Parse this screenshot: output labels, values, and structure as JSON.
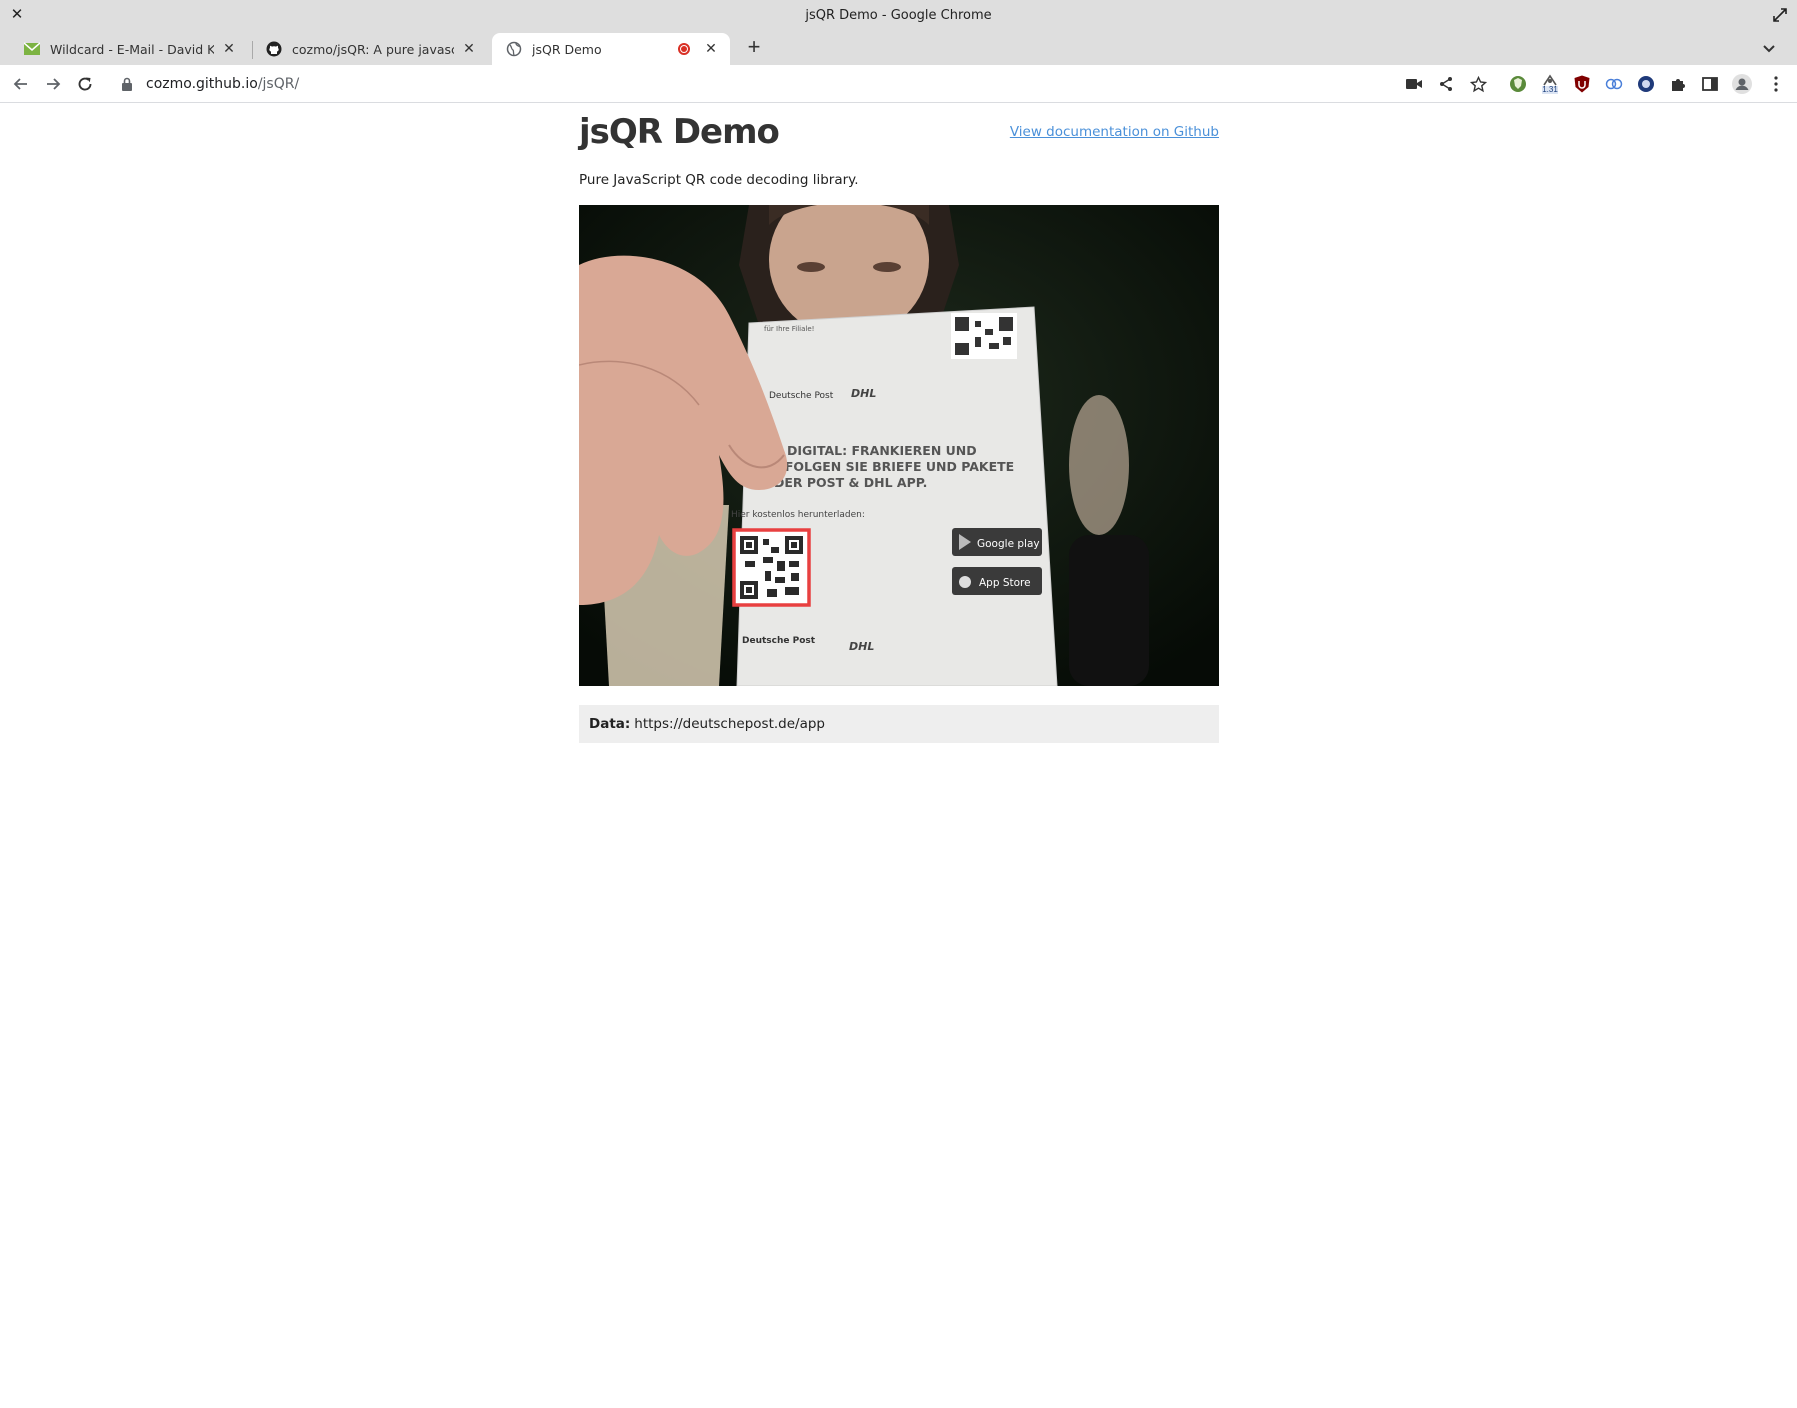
{
  "window": {
    "title": "jsQR Demo - Google Chrome"
  },
  "tabs": [
    {
      "label": "Wildcard - E-Mail - David Kleuk",
      "icon": "mail-icon",
      "active": false
    },
    {
      "label": "cozmo/jsQR: A pure javascript QR",
      "icon": "github-icon",
      "active": false
    },
    {
      "label": "jsQR Demo",
      "icon": "globe-icon",
      "active": true,
      "recording": true
    }
  ],
  "toolbar": {
    "url_host": "cozmo.github.io",
    "url_path": "/jsQR/",
    "extension_badge": "1.31"
  },
  "page": {
    "title": "jsQR Demo",
    "doc_link": "View documentation on Github",
    "subtitle": "Pure JavaScript QR code decoding library.",
    "output_label": "Data:",
    "output_value": "https://deutschepost.de/app"
  },
  "video": {
    "receipt_lines": [
      "für Ihre Filiale!",
      "Deutsche Post",
      "DHL",
      "DIGITAL: FRANKIEREN UND",
      "VERFOLGEN SIE BRIEFE UND PAKETE",
      "MIT DER POST & DHL APP.",
      "Hier kostenlos herunterladen:",
      "Google play",
      "App Store"
    ],
    "highlight_color": "#e84040"
  }
}
